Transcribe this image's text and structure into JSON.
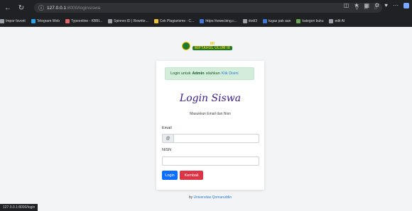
{
  "browser": {
    "url_host": "127.0.0.1",
    "url_path": ":8000/loginsiswa",
    "bookmarks": [
      {
        "label": "Impor favorit",
        "color": "#9aa0a6"
      },
      {
        "label": "Telegram Web",
        "color": "#2aa3ef"
      },
      {
        "label": "Typeonline - KBBI...",
        "color": "#e06666"
      },
      {
        "label": "Spinner.ID | Rewrite...",
        "color": "#9aa0a6"
      },
      {
        "label": "Cek Plagiarisme - C...",
        "color": "#f1c232"
      },
      {
        "label": "https://www.bing.c...",
        "color": "#3c78d8"
      },
      {
        "label": "dodi3",
        "color": "#9aa0a6"
      },
      {
        "label": "tugas pak aan",
        "color": "#3c78d8"
      },
      {
        "label": "kategori buku",
        "color": "#6aa84f"
      },
      {
        "label": "edit AI",
        "color": "#9aa0a6"
      }
    ]
  },
  "logo": {
    "line1": "MI",
    "line2": "MIFTAHUL ULUM III"
  },
  "alert": {
    "prefix": "Login untuk",
    "bold": "Admin",
    "suffix": "silahkan",
    "link": "Klik Disini"
  },
  "form": {
    "title": "Login Siswa",
    "subtitle": "Masukkan Email dan Nisn",
    "email_label": "Email",
    "email_prefix": "@",
    "email_value": "",
    "nisn_label": "NISN",
    "nisn_value": "",
    "login_button": "Login",
    "back_button": "Kembali"
  },
  "footer": {
    "prefix": "by",
    "link": "Universitas Qomaruddin"
  },
  "status_url": "127.0.0.1:8000/login"
}
